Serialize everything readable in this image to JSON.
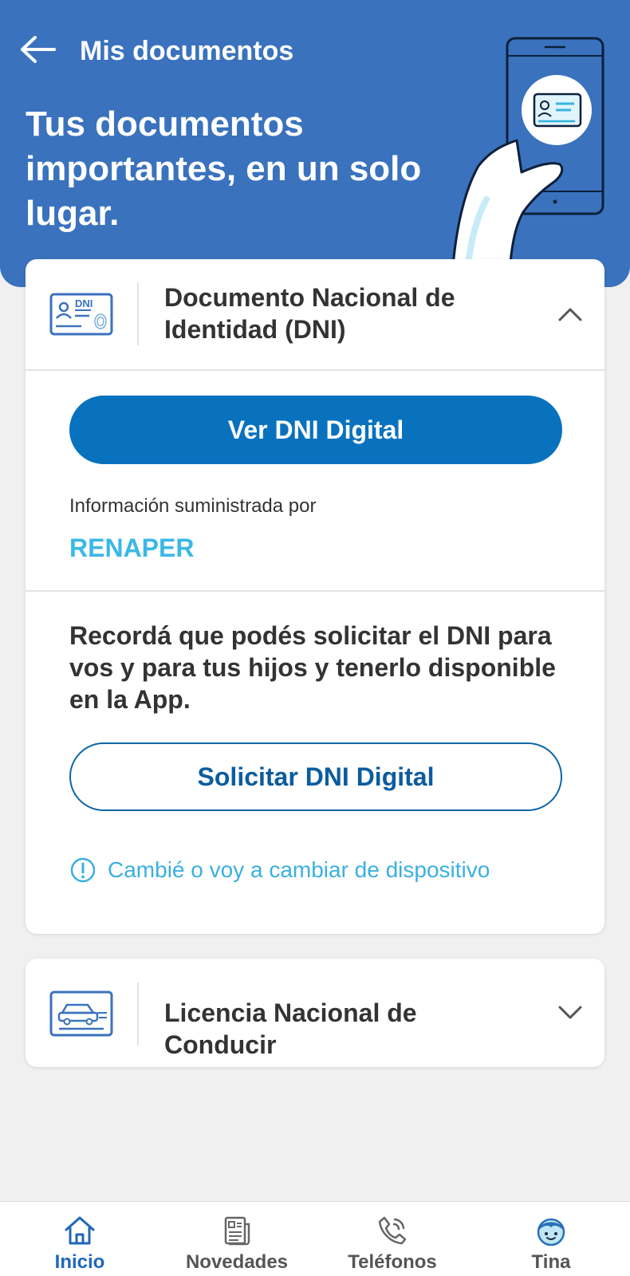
{
  "header": {
    "back_icon": "arrow-left-icon",
    "title": "Mis documentos",
    "hero_heading": "Tus documentos importantes, en un solo lugar.",
    "illustration": "hand-holding-phone-with-id-card",
    "color": "#3a72bd"
  },
  "documents": [
    {
      "icon": "dni-card-icon",
      "icon_text": "DNI",
      "title": "Documento Nacional de Identidad (DNI)",
      "expanded": true,
      "chevron": "chevron-up-icon",
      "primary_button": "Ver DNI Digital",
      "info_label": "Información suministrada por",
      "provider": "RENAPER",
      "reminder": "Recordá que podés solicitar el DNI para vos y para tus hijos y tenerlo disponible en la App.",
      "secondary_button": "Solicitar DNI Digital",
      "device_link": "Cambié o voy a cambiar de dispositivo"
    },
    {
      "icon": "driver-license-car-icon",
      "title": "Licencia Nacional de Conducir",
      "expanded": false,
      "chevron": "chevron-down-icon"
    }
  ],
  "bottom_nav": [
    {
      "label": "Inicio",
      "icon": "home-icon",
      "active": true
    },
    {
      "label": "Novedades",
      "icon": "newspaper-icon",
      "active": false
    },
    {
      "label": "Teléfonos",
      "icon": "phone-icon",
      "active": false
    },
    {
      "label": "Tina",
      "icon": "tina-assistant-icon",
      "active": false
    }
  ],
  "colors": {
    "primary": "#0872bf",
    "link": "#3bb8e6",
    "active_nav": "#1f67b8",
    "background": "#f0f0f0"
  }
}
